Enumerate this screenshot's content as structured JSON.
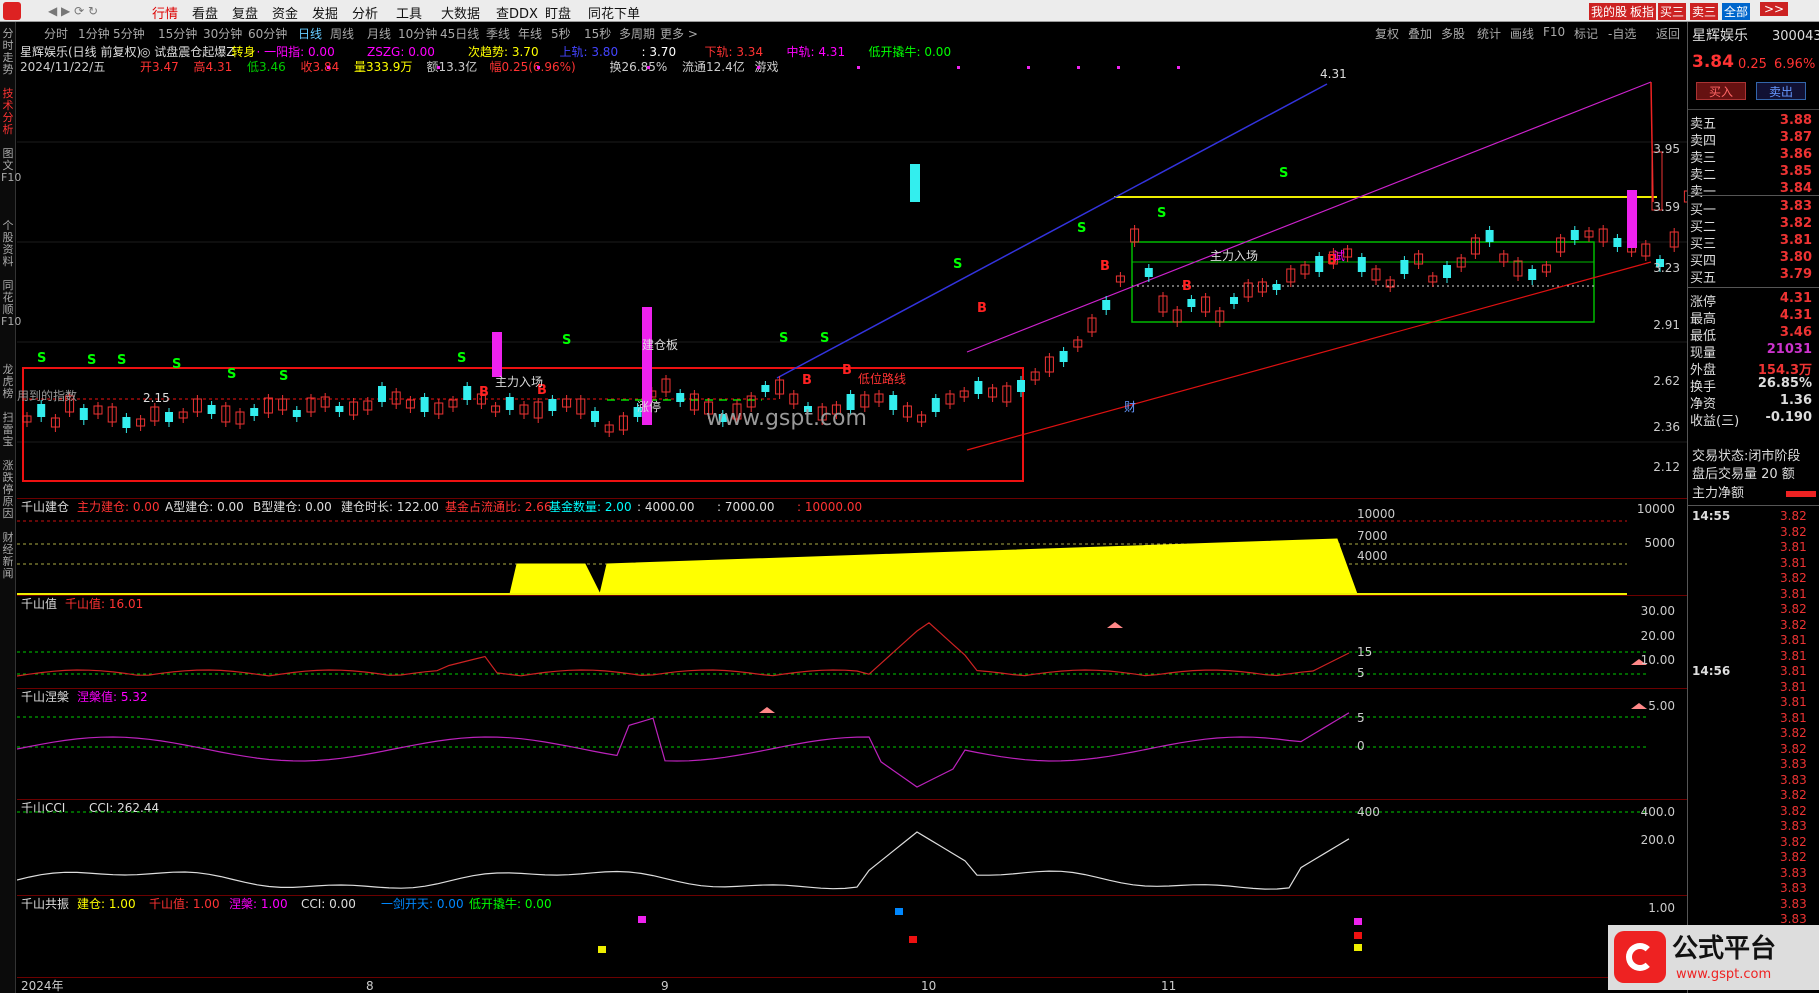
{
  "menu": {
    "items": [
      "行情",
      "看盘",
      "复盘",
      "资金",
      "发掘",
      "分析",
      "工具",
      "大数据",
      "查DDX",
      "盯盘",
      "同花下单"
    ],
    "right_tags": [
      "我的股",
      "板指",
      "买三",
      "卖三",
      "全部"
    ]
  },
  "timeframes": [
    "分时",
    "1分钟",
    "5分钟",
    "15分钟",
    "30分钟",
    "60分钟",
    "日线",
    "周线",
    "月线",
    "10分钟",
    "45日线",
    "季线",
    "年线",
    "5秒",
    "15秒",
    "多周期",
    "更多 >"
  ],
  "toolbar_right": [
    "复权",
    "叠加",
    "多股",
    "统计",
    "画线",
    "F10",
    "标记",
    "-自选",
    "返回"
  ],
  "left_sidebar": [
    "分时走势",
    "技术分析",
    "图文F10",
    "个股资料",
    "同花顺F10",
    "龙虎榜",
    "扫雷宝",
    "涨跌停原因",
    "财经新闻"
  ],
  "stock": {
    "name": "星辉娱乐",
    "code": "300043",
    "price": "3.84",
    "change": "0.25",
    "pct": "6.96%",
    "title": "星辉娱乐(日线 前复权)"
  },
  "indicator_line1": [
    {
      "t": "星辉娱乐(日线 前复权)",
      "c": "#ddd"
    },
    {
      "t": "◎ 试盘震仓起爆Z",
      "c": "#ddd"
    },
    {
      "t": "转身",
      "c": "#ff0"
    },
    {
      "t": "· 一阳指: 0.00",
      "c": "#f0f"
    },
    {
      "t": "ZSZG: 0.00",
      "c": "#f0f"
    },
    {
      "t": "次趋势: 3.70",
      "c": "#ff0"
    },
    {
      "t": "上轨: 3.80",
      "c": "#44f"
    },
    {
      "t": ": 3.70",
      "c": "#fff"
    },
    {
      "t": "下轨: 3.34",
      "c": "#f33"
    },
    {
      "t": "中轨: 4.31",
      "c": "#f0f"
    },
    {
      "t": "低开撬牛: 0.00",
      "c": "#0f0"
    }
  ],
  "indicator_line2": [
    {
      "t": "2024/11/22/五",
      "c": "#ccc"
    },
    {
      "t": "开3.47",
      "c": "#f33"
    },
    {
      "t": "高4.31",
      "c": "#f33"
    },
    {
      "t": "低3.46",
      "c": "#0c0"
    },
    {
      "t": "收3.84",
      "c": "#f33"
    },
    {
      "t": "量333.9万",
      "c": "#ff0"
    },
    {
      "t": "额13.3亿",
      "c": "#ccc"
    },
    {
      "t": "幅0.25(6.96%)",
      "c": "#f33"
    },
    {
      "t": "换26.85%",
      "c": "#ccc"
    },
    {
      "t": "流通12.4亿",
      "c": "#ccc"
    },
    {
      "t": "游戏",
      "c": "#ccc"
    }
  ],
  "main_axis": [
    "3.95",
    "3.59",
    "3.23",
    "2.91",
    "2.62",
    "2.36",
    "2.12"
  ],
  "main_labels": {
    "high": "4.31",
    "low": "2.15",
    "zhuli1": "主力入场",
    "zhuli2": "主力入场",
    "jiancang": "建仓板",
    "zhangting": "涨停",
    "dixi": "低位路线",
    "shi": "试",
    "cai": "财",
    "watermark": "www.gspt.com",
    "yongdao": "用到的指数"
  },
  "ob_asks": [
    {
      "k": "卖五",
      "v": "3.88"
    },
    {
      "k": "卖四",
      "v": "3.87"
    },
    {
      "k": "卖三",
      "v": "3.86"
    },
    {
      "k": "卖二",
      "v": "3.85"
    },
    {
      "k": "卖一",
      "v": "3.84"
    }
  ],
  "ob_bids": [
    {
      "k": "买一",
      "v": "3.83"
    },
    {
      "k": "买二",
      "v": "3.82"
    },
    {
      "k": "买三",
      "v": "3.81"
    },
    {
      "k": "买四",
      "v": "3.80"
    },
    {
      "k": "买五",
      "v": "3.79"
    }
  ],
  "quote": [
    {
      "k": "涨停",
      "v": "4.31"
    },
    {
      "k": "最高",
      "v": "4.31"
    },
    {
      "k": "最低",
      "v": "3.46"
    },
    {
      "k": "现量",
      "v": "21031"
    },
    {
      "k": "外盘",
      "v": "154.3万"
    },
    {
      "k": "换手",
      "v": "26.85%"
    },
    {
      "k": "净资",
      "v": "1.36"
    },
    {
      "k": "收益(三)",
      "v": "-0.190"
    }
  ],
  "trade_state": "交易状态:闭市阶段",
  "after_trade": "盘后交易量 20 额",
  "zhuli_label": "主力净额",
  "tick_time1": "14:55",
  "tick_time2": "14:56",
  "ticks1": [
    "3.82",
    "3.82",
    "3.81",
    "3.81",
    "3.82",
    "3.81",
    "3.82",
    "3.82",
    "3.81",
    "3.81"
  ],
  "ticks2": [
    "3.81",
    "3.81",
    "3.81",
    "3.81",
    "3.82",
    "3.82",
    "3.83",
    "3.83",
    "3.82",
    "3.82",
    "3.83",
    "3.82",
    "3.82",
    "3.83",
    "3.83",
    "3.83",
    "3.83",
    "3.83",
    "3.82",
    "3.81",
    "3.82"
  ],
  "buy_btn": "买入",
  "sell_btn": "卖出",
  "pane1": {
    "title": "千山建仓",
    "items": [
      {
        "t": "主力建仓: 0.00",
        "c": "#f33"
      },
      {
        "t": "A型建仓: 0.00",
        "c": "#ddd"
      },
      {
        "t": "B型建仓: 0.00",
        "c": "#ddd"
      },
      {
        "t": "建仓时长: 122.00",
        "c": "#ddd"
      },
      {
        "t": "基金占流通比: 2.66",
        "c": "#f33"
      },
      {
        "t": "基金数量: 2.00",
        "c": "#0ff"
      },
      {
        "t": ": 4000.00",
        "c": "#ddd"
      },
      {
        "t": ": 7000.00",
        "c": "#ddd"
      },
      {
        "t": ": 10000.00",
        "c": "#f33"
      }
    ],
    "axis": [
      "10000",
      "5000"
    ],
    "inner": [
      "10000",
      "7000",
      "4000"
    ]
  },
  "pane2": {
    "title": "千山值",
    "items": [
      {
        "t": "千山值: 16.01",
        "c": "#f33"
      }
    ],
    "axis": [
      "30.00",
      "20.00",
      "10.00"
    ],
    "inner": [
      "15",
      "5"
    ]
  },
  "pane3": {
    "title": "千山涅槃",
    "items": [
      {
        "t": "涅槃值: 5.32",
        "c": "#f0f"
      }
    ],
    "axis": [
      "5.00"
    ],
    "inner": [
      "5",
      "0"
    ]
  },
  "pane4": {
    "title": "千山CCI",
    "items": [
      {
        "t": "CCI: 262.44",
        "c": "#ddd"
      }
    ],
    "axis": [
      "400.0",
      "200.0"
    ],
    "inner": [
      "400"
    ]
  },
  "pane5": {
    "title": "千山共振",
    "items": [
      {
        "t": "建仓: 1.00",
        "c": "#ff0"
      },
      {
        "t": "千山值: 1.00",
        "c": "#f33"
      },
      {
        "t": "涅槃: 1.00",
        "c": "#f0f"
      },
      {
        "t": "CCI: 0.00",
        "c": "#ddd"
      },
      {
        "t": "一剑开天: 0.00",
        "c": "#08f"
      },
      {
        "t": "低开撬牛: 0.00",
        "c": "#0f0"
      }
    ],
    "axis": [
      "1.00"
    ]
  },
  "xaxis": [
    "2024年",
    "8",
    "9",
    "10",
    "11"
  ],
  "logo_text": "公式平台",
  "logo_url": "www.gspt.com"
}
